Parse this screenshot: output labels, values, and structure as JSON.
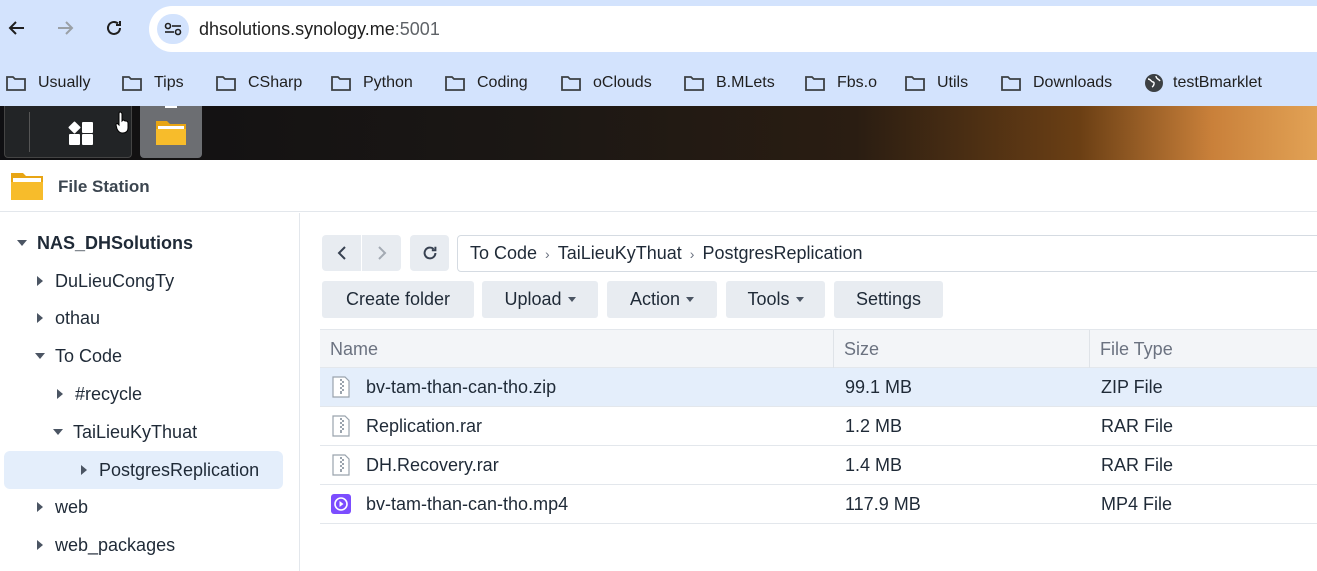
{
  "browser": {
    "url_host": "dhsolutions.synology.me",
    "url_port": ":5001",
    "bookmarks": [
      "Usually",
      "Tips",
      "CSharp",
      "Python",
      "Coding",
      "oClouds",
      "B.MLets",
      "Fbs.o",
      "Utils",
      "Downloads",
      "testBmarklet"
    ]
  },
  "window": {
    "title": "File Station"
  },
  "sidebar": {
    "root": "NAS_DHSolutions",
    "items": [
      "DuLieuCongTy",
      "othau",
      "To Code",
      "#recycle",
      "TaiLieuKyThuat",
      "PostgresReplication",
      "web",
      "web_packages"
    ]
  },
  "path": {
    "segments": [
      "To Code",
      "TaiLieuKyThuat",
      "PostgresReplication"
    ]
  },
  "toolbar": {
    "create_folder": "Create folder",
    "upload": "Upload",
    "action": "Action",
    "tools": "Tools",
    "settings": "Settings"
  },
  "table": {
    "columns": [
      "Name",
      "Size",
      "File Type"
    ],
    "rows": [
      {
        "name": "bv-tam-than-can-tho.zip",
        "size": "99.1 MB",
        "type": "ZIP File"
      },
      {
        "name": "Replication.rar",
        "size": "1.2 MB",
        "type": "RAR File"
      },
      {
        "name": "DH.Recovery.rar",
        "size": "1.4 MB",
        "type": "RAR File"
      },
      {
        "name": "bv-tam-than-can-tho.mp4",
        "size": "117.9 MB",
        "type": "MP4 File"
      }
    ]
  },
  "colors": {
    "chrome": "#d3e3fd",
    "selection": "#e4eefb",
    "button": "#e8ecf1",
    "video_icon": "#7c4dff"
  }
}
